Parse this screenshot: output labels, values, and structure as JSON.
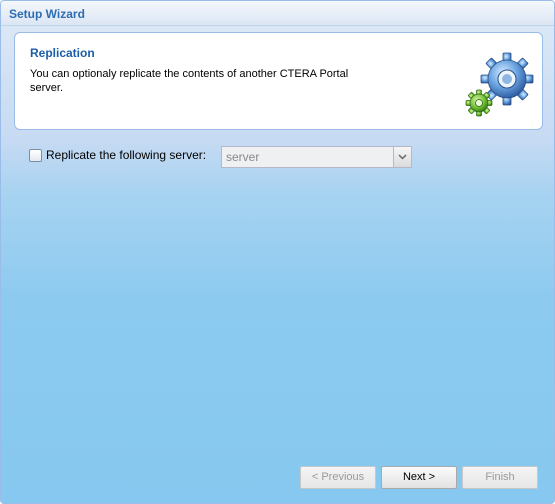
{
  "window": {
    "title": "Setup Wizard"
  },
  "header": {
    "title": "Replication",
    "description": "You can optionaly replicate the contents of another CTERA Portal server.",
    "icon": "gears-icon"
  },
  "replicate": {
    "checked": false,
    "label": "Replicate the following server:",
    "server_value": "server"
  },
  "buttons": {
    "previous": "< Previous",
    "next": "Next >",
    "finish": "Finish"
  }
}
